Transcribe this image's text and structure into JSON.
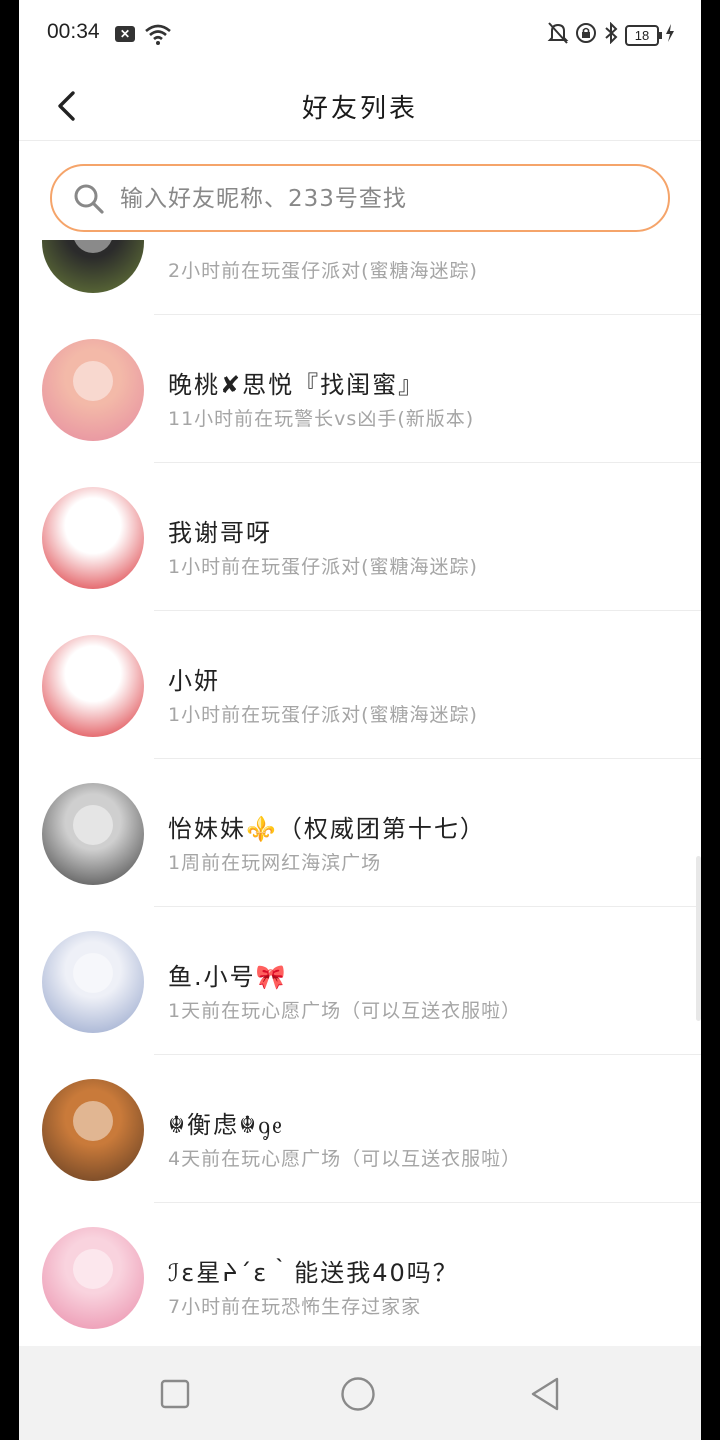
{
  "status_bar": {
    "time": "00:34",
    "notification_badge": "✕",
    "battery": "18"
  },
  "header": {
    "title": "好友列表",
    "back_icon": "chevron-left-icon"
  },
  "search": {
    "placeholder": "输入好友昵称、233号查找",
    "value": ""
  },
  "friends": [
    {
      "name": "",
      "status": "2小时前在玩蛋仔派对(蜜糖海迷踪)",
      "avatar_colors": [
        "#2b2b2b",
        "#6b7f3a"
      ]
    },
    {
      "name": "晚桃✘思悦『找闺蜜』",
      "status": "11小时前在玩警长vs凶手(新版本)",
      "avatar_colors": [
        "#f3b9a8",
        "#e58aa0"
      ]
    },
    {
      "name": "我谢哥呀",
      "status": "1小时前在玩蛋仔派对(蜜糖海迷踪)",
      "avatar_colors": [
        "#ffffff",
        "#d8232a"
      ]
    },
    {
      "name": "小妍",
      "status": "1小时前在玩蛋仔派对(蜜糖海迷踪)",
      "avatar_colors": [
        "#ffffff",
        "#d8232a"
      ]
    },
    {
      "name": "怡妹妹⚜️（权威团第十七）",
      "status": "1周前在玩网红海滨广场",
      "avatar_colors": [
        "#cfcfcf",
        "#3a3a3a"
      ]
    },
    {
      "name": "鱼.小号🎀",
      "status": "1天前在玩心愿广场（可以互送衣服啦）",
      "avatar_colors": [
        "#eef0f7",
        "#8fa0c8"
      ]
    },
    {
      "name": "☬衡虑☬ᧁᧉ",
      "status": "4天前在玩心愿广场（可以互送衣服啦）",
      "avatar_colors": [
        "#c97a3a",
        "#5c3a22"
      ]
    },
    {
      "name": "ℐɛ星ᔨ΄ɛ｀能送我40吗？",
      "status": "7小时前在玩恐怖生存过家家",
      "avatar_colors": [
        "#f9d3de",
        "#e98aa8"
      ]
    }
  ],
  "nav_bar": {
    "recents_icon": "square-icon",
    "home_icon": "circle-icon",
    "back_icon": "triangle-back-icon"
  }
}
